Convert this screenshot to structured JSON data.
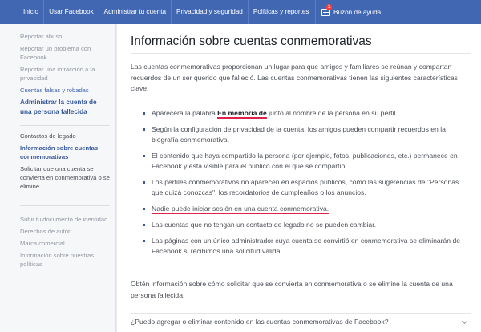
{
  "topnav": {
    "items": [
      "Inicio",
      "Usar Facebook",
      "Administrar tu cuenta",
      "Privacidad y seguridad",
      "Políticas y reportes"
    ],
    "inbox_label": "Buzón de ayuda",
    "inbox_badge": "1",
    "inbox_icon": "inbox-icon"
  },
  "sidebar": {
    "group1": [
      "Reportar abuso",
      "Reportar un problema con Facebook",
      "Reportar una infracción a la privacidad",
      "Cuentas falsas y robadas"
    ],
    "active": "Administrar la cuenta de una persona fallecida",
    "sub": [
      "Contactos de legado",
      "Información sobre cuentas conmemorativas",
      "Solicitar que una cuenta se convierta en conmemorativa o se elimine"
    ],
    "group2": [
      "Subir tu documento de identidad",
      "Derechos de autor",
      "Marca comercial",
      "Información sobre nuestras políticas"
    ]
  },
  "main": {
    "title": "Información sobre cuentas conmemorativas",
    "intro": "Las cuentas conmemorativas proporcionan un lugar para que amigos y familiares se reúnan y compartan recuerdos de un ser querido que falleció. Las cuentas conmemorativas tienen las siguientes características clave:",
    "bullet1_pre": "Aparecerá la palabra ",
    "bullet1_bold": "En memoria de",
    "bullet1_post": " junto al nombre de la persona en su perfil.",
    "bullets": [
      "Según la configuración de privacidad de la cuenta, los amigos pueden compartir recuerdos en la biografía conmemorativa.",
      "El contenido que haya compartido la persona (por ejemplo, fotos, publicaciones, etc.) permanece en Facebook y está visible para el público con el que se compartió.",
      "Los perfiles conmemorativos no aparecen en espacios públicos, como las sugerencias de \"Personas que quizá conozcas\", los recordatorios de cumpleaños o los anuncios."
    ],
    "bullet_underlined": "Nadie puede iniciar sesión en una cuenta conmemorativa.",
    "bullets_after": [
      "Las cuentas que no tengan un contacto de legado no se pueden cambiar.",
      "Las páginas con un único administrador cuya cuenta se convirtió en conmemorativa se eliminarán de Facebook si recibimos una solicitud válida."
    ],
    "outro": "Obtén información sobre cómo solicitar que se convierta en conmemorativa o se elimine la cuenta de una persona fallecida.",
    "faq": "¿Puedo agregar o eliminar contenido en las cuentas conmemorativas de Facebook?"
  }
}
